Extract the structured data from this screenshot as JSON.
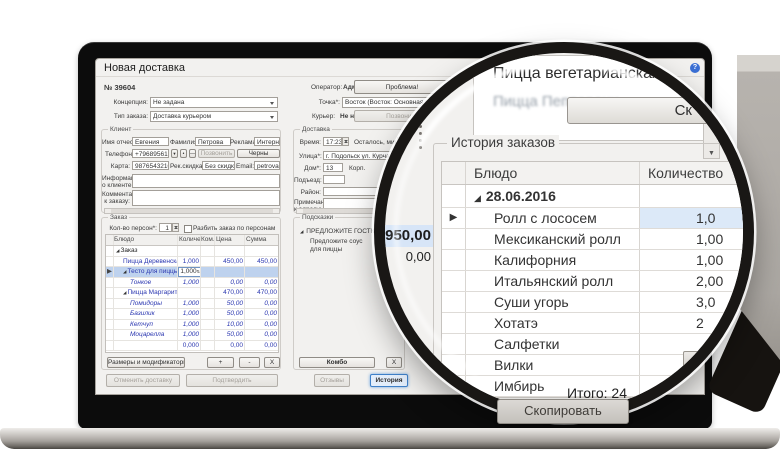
{
  "window": {
    "title": "Новая доставка",
    "help_icon": "?"
  },
  "header": {
    "number_label": "№",
    "number": "39604",
    "operator_label": "Оператор:",
    "operator_value": "Администратор",
    "problem_button": "Проблема!",
    "concept_label": "Концепция:",
    "concept_value": "Не задана",
    "point_label": "Точка*:",
    "point_value": "Восток (Восток: Основная группа)",
    "type_label": "Тип заказа:",
    "type_value": "Доставка курьером",
    "courier_label": "Курьер:",
    "courier_value": "Не назначен",
    "call_button": "Позвонить"
  },
  "client": {
    "title": "Клиент",
    "name_label": "Имя отчество*:",
    "name_value": "Евгения",
    "surname_label": "Фамилия:",
    "surname_value": "Петрова",
    "ad_label": "Реклама:",
    "ad_value": "Интернет",
    "phone_label": "Телефон*:",
    "phone_value": "+79689561245",
    "call_button": "Позвонить",
    "blacklist_button": "Черны",
    "card_label": "Карта:",
    "card_value": "9876543210",
    "discount_label": "Рек.скидка:",
    "discount_value": "Без скидки",
    "email_label": "Email:",
    "email_value": "petrova@gm",
    "info_label1": "Информация",
    "info_label2": "о клиенте:",
    "comment_label1": "Комментарий",
    "comment_label2": "к заказу:"
  },
  "delivery": {
    "title": "Доставка",
    "time_label": "Время:",
    "time_value": "17:23",
    "left_label": "Осталось, мин:",
    "street_label": "Улица*:",
    "street_value": "г. Подольск ул. Курчатова",
    "house_label": "Дом*:",
    "house_value": "13",
    "korp_label": "Корп.",
    "entrance_label": "Подъезд:",
    "district_label": "Район:",
    "note_label1": "Примечание",
    "note_label2": "к адресу:"
  },
  "order": {
    "title": "Заказ",
    "persons_label": "Кол-во персон*:",
    "persons_value": "1",
    "split_label": "Разбить заказ по персонам",
    "columns": [
      "Блюдо",
      "Количество",
      "Ком...",
      "Цена",
      "Сумма"
    ],
    "rows": [
      {
        "level": 0,
        "name": "Заказ",
        "group": true,
        "expand": true,
        "qty": "",
        "price": "",
        "sum": ""
      },
      {
        "level": 1,
        "name": "Пицца Деревенская",
        "qty": "1,000",
        "price": "450,00",
        "sum": "450,00"
      },
      {
        "level": 1,
        "name": "Тесто для пиццы S...",
        "qty": "1,000",
        "selected": true,
        "expand": true,
        "price": "",
        "sum": ""
      },
      {
        "level": 2,
        "name": "Тонкое",
        "mod": true,
        "qty": "1,000",
        "price": "0,00",
        "sum": "0,00"
      },
      {
        "level": 1,
        "name": "Пицца Маргарита",
        "expand": true,
        "qty": "",
        "price": "470,00",
        "sum": "470,00"
      },
      {
        "level": 2,
        "name": "Помидоры",
        "mod": true,
        "qty": "1,000",
        "price": "50,00",
        "sum": "0,00"
      },
      {
        "level": 2,
        "name": "Базилик",
        "mod": true,
        "qty": "1,000",
        "price": "50,00",
        "sum": "0,00"
      },
      {
        "level": 2,
        "name": "Кетчуп",
        "mod": true,
        "qty": "1,000",
        "price": "10,00",
        "sum": "0,00"
      },
      {
        "level": 2,
        "name": "Моцарелла",
        "mod": true,
        "qty": "1,000",
        "price": "50,00",
        "sum": "0,00"
      },
      {
        "level": 1,
        "name": "",
        "qty": "0,000",
        "price": "0,00",
        "sum": "0,00"
      }
    ],
    "sizes_button": "Размеры и модификаторы",
    "add_button": "+",
    "minus_button": "-",
    "delete_button": "X"
  },
  "hints": {
    "title": "Подсказки",
    "group": "ПРЕДЛОЖИТЕ ГОСТЮ",
    "item": "Предложите соус для пиццы",
    "combo_button": "Комбо",
    "x_button": "X"
  },
  "footer": {
    "cancel_button": "Отменить доставку",
    "confirm_button": "Подтвердить",
    "reviews_button": "Отзывы",
    "history_button": "История"
  },
  "magnifier": {
    "menu_items": [
      "Пицца вегетарианская",
      "Пицца Пепперони"
    ],
    "action_button": "Ск",
    "scroll_up_icon": "▲",
    "scroll_down_icon": "▼",
    "totals": {
      "sum": "950,00",
      "discount": "0,00"
    },
    "history": {
      "title": "История заказов",
      "columns": [
        "Блюдо",
        "Количество"
      ],
      "date_group": "28.06.2016",
      "rows": [
        {
          "name": "Ролл с лососем",
          "qty": "1,0",
          "selected": true
        },
        {
          "name": "Мексиканский ролл",
          "qty": "1,00"
        },
        {
          "name": "Калифорния",
          "qty": "1,00"
        },
        {
          "name": "Итальянский ролл",
          "qty": "2,00"
        },
        {
          "name": "Суши угорь",
          "qty": "3,0"
        },
        {
          "name": "Хотатэ",
          "qty": "2"
        },
        {
          "name": "Салфетки",
          "qty": ""
        },
        {
          "name": "Вилки",
          "qty": ""
        },
        {
          "name": "Имбирь",
          "qty": ""
        }
      ],
      "total": "Итого: 24",
      "copy_button": "Скопировать"
    }
  },
  "colors": {
    "accent_blue": "#3f81c9",
    "selection": "#bed2ee",
    "item_blue": "#2a36b0",
    "glass_rim": "#191715"
  }
}
